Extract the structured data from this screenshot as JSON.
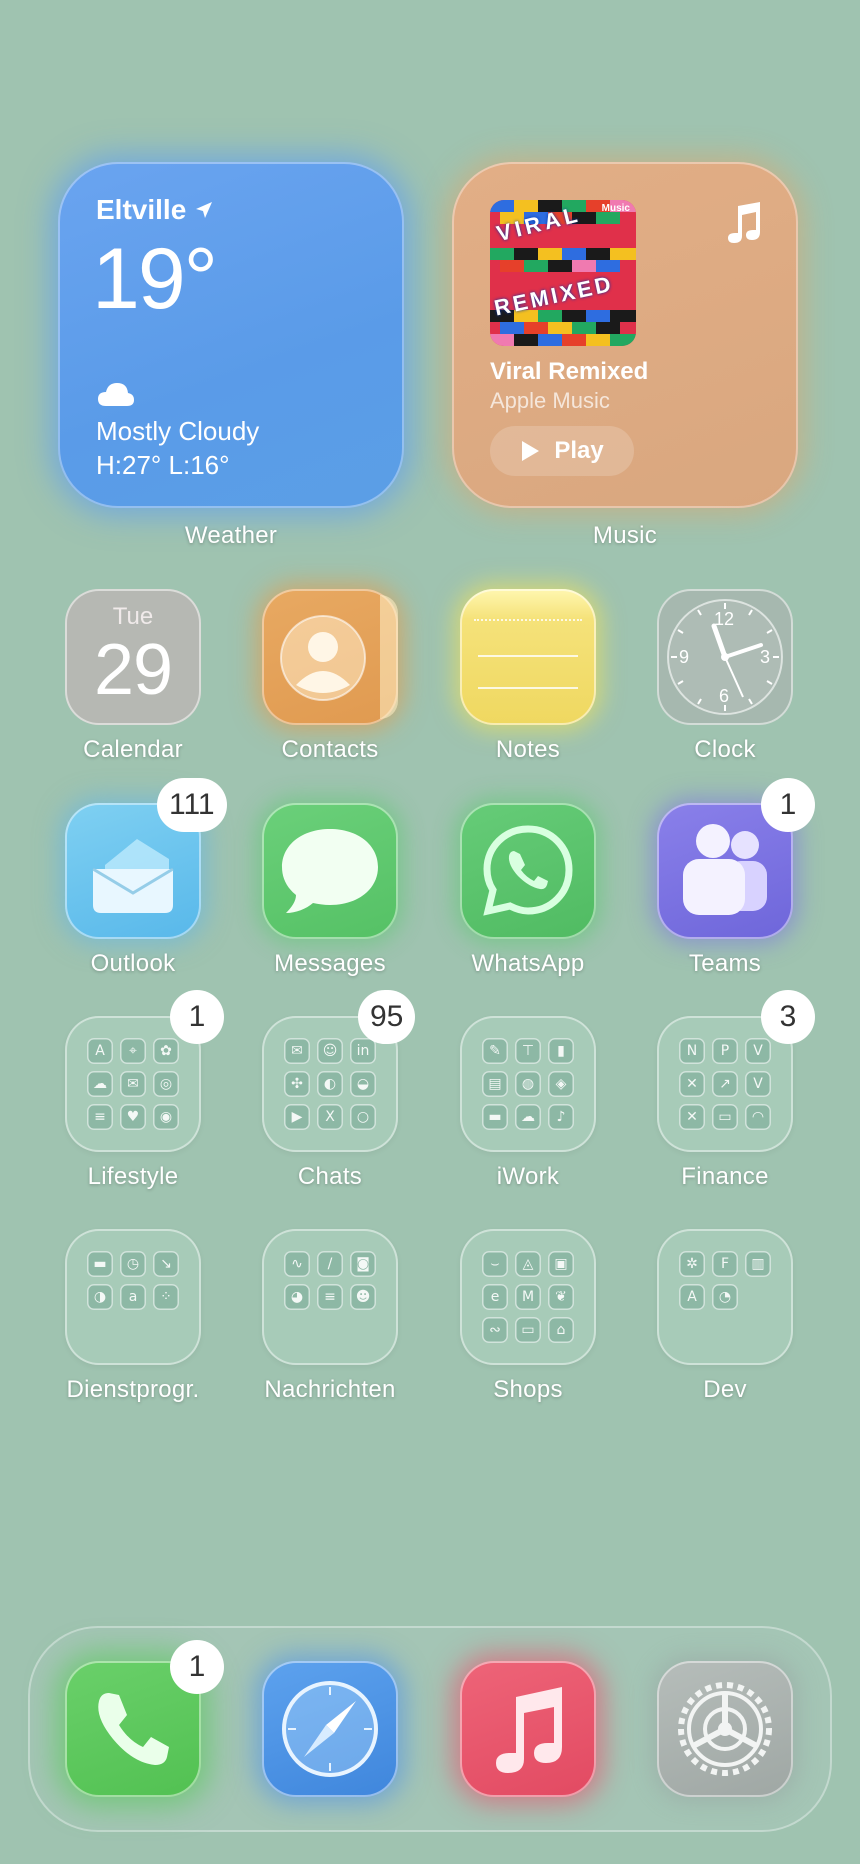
{
  "widgets": {
    "weather": {
      "location": "Eltville",
      "location_icon": "location-arrow-icon",
      "temperature": "19°",
      "condition_icon": "cloud-icon",
      "condition": "Mostly Cloudy",
      "high_low": "H:27° L:16°",
      "label": "Weather"
    },
    "music": {
      "title": "Viral Remixed",
      "subtitle": "Apple Music",
      "play_label": "Play",
      "label": "Music",
      "art_brand": "Music",
      "art_words": [
        "VIRAL",
        "REMIXED"
      ]
    }
  },
  "calendar": {
    "weekday": "Tue",
    "day": "29"
  },
  "clock": {
    "numerals": [
      "12",
      "3",
      "6",
      "9"
    ]
  },
  "apps_row1": [
    {
      "name": "Calendar"
    },
    {
      "name": "Contacts"
    },
    {
      "name": "Notes"
    },
    {
      "name": "Clock"
    }
  ],
  "apps_row2": [
    {
      "name": "Outlook",
      "badge": "111"
    },
    {
      "name": "Messages"
    },
    {
      "name": "WhatsApp"
    },
    {
      "name": "Teams",
      "badge": "1"
    }
  ],
  "folders_row1": [
    {
      "name": "Lifestyle",
      "badge": "1"
    },
    {
      "name": "Chats",
      "badge": "95"
    },
    {
      "name": "iWork"
    },
    {
      "name": "Finance",
      "badge": "3"
    }
  ],
  "folders_row2": [
    {
      "name": "Dienstprogr."
    },
    {
      "name": "Nachrichten"
    },
    {
      "name": "Shops"
    },
    {
      "name": "Dev"
    }
  ],
  "dock": {
    "phone_badge": "1",
    "apps": [
      "phone",
      "safari",
      "music",
      "settings"
    ]
  },
  "colors": {
    "background": "#9fc3b0",
    "weather": "#5a9be8",
    "music_widget": "#d9a77f",
    "contacts": "#e5a25a",
    "notes": "#f2e070",
    "outlook": "#6cc4ee",
    "messages": "#5ec86a",
    "whatsapp": "#58c06a",
    "teams": "#7a70e0",
    "phone": "#5cc45e",
    "safari": "#4a90e2",
    "music_app": "#e8546a",
    "settings": "#a9b0ad"
  }
}
